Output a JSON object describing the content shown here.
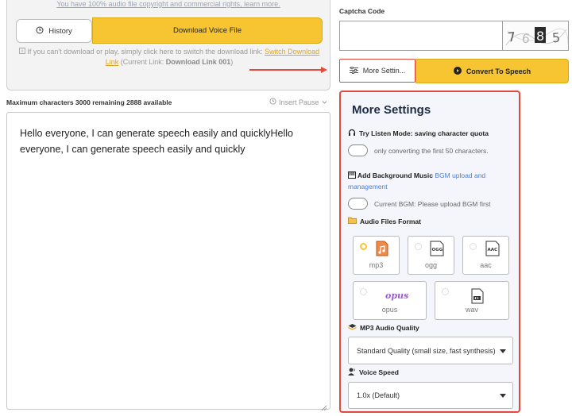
{
  "download_card": {
    "rights_text": "You have 100% audio file copyright and commercial rights, learn more.",
    "history_label": "History",
    "download_label": "Download Voice File",
    "note_prefix": "If you can't download or play, simply click here to switch the download link:",
    "switch_link_a": "Switch Download",
    "switch_link_b": "Link",
    "current_prefix": "(Current Link:",
    "current_link": "Download Link 001",
    "current_suffix": ")"
  },
  "editor": {
    "max_chars_text": "Maximum characters 3000 remaining 2888 available",
    "insert_pause": "Insert Pause",
    "content": "Hello everyone, I can generate speech easily and quicklyHello everyone, I can generate speech easily and quickly"
  },
  "captcha": {
    "label": "Captcha Code",
    "value": "",
    "digits": [
      "7",
      "6",
      "8",
      "5"
    ]
  },
  "actions": {
    "more_settings": "More Settin...",
    "convert": "Convert To Speech"
  },
  "settings": {
    "title": "More Settings",
    "listen_mode_label": "Try Listen Mode: saving character quota",
    "listen_mode_toggle_text": "only converting the first 50 characters.",
    "listen_mode_on": false,
    "bgm_label": "Add Background Music",
    "bgm_link_a": "BGM upload and",
    "bgm_link_b": "management",
    "bgm_toggle_text": "Current BGM: Please upload BGM first",
    "bgm_on": false,
    "format_label": "Audio Files Format",
    "formats": [
      {
        "name": "mp3",
        "selected": true
      },
      {
        "name": "ogg",
        "selected": false
      },
      {
        "name": "aac",
        "selected": false
      },
      {
        "name": "opus",
        "selected": false
      },
      {
        "name": "wav",
        "selected": false
      }
    ],
    "ogg_icon_text": "OGG",
    "aac_icon_text": "AAC",
    "opus_logo_text": "opus",
    "quality_label": "MP3 Audio Quality",
    "quality_value": "Standard Quality (small size, fast synthesis)",
    "speed_label": "Voice Speed",
    "speed_value": "1.0x (Default)"
  },
  "colors": {
    "accent_yellow": "#f6c531",
    "highlight_red": "#e24a3b",
    "link_blue": "#4a7fd1"
  }
}
